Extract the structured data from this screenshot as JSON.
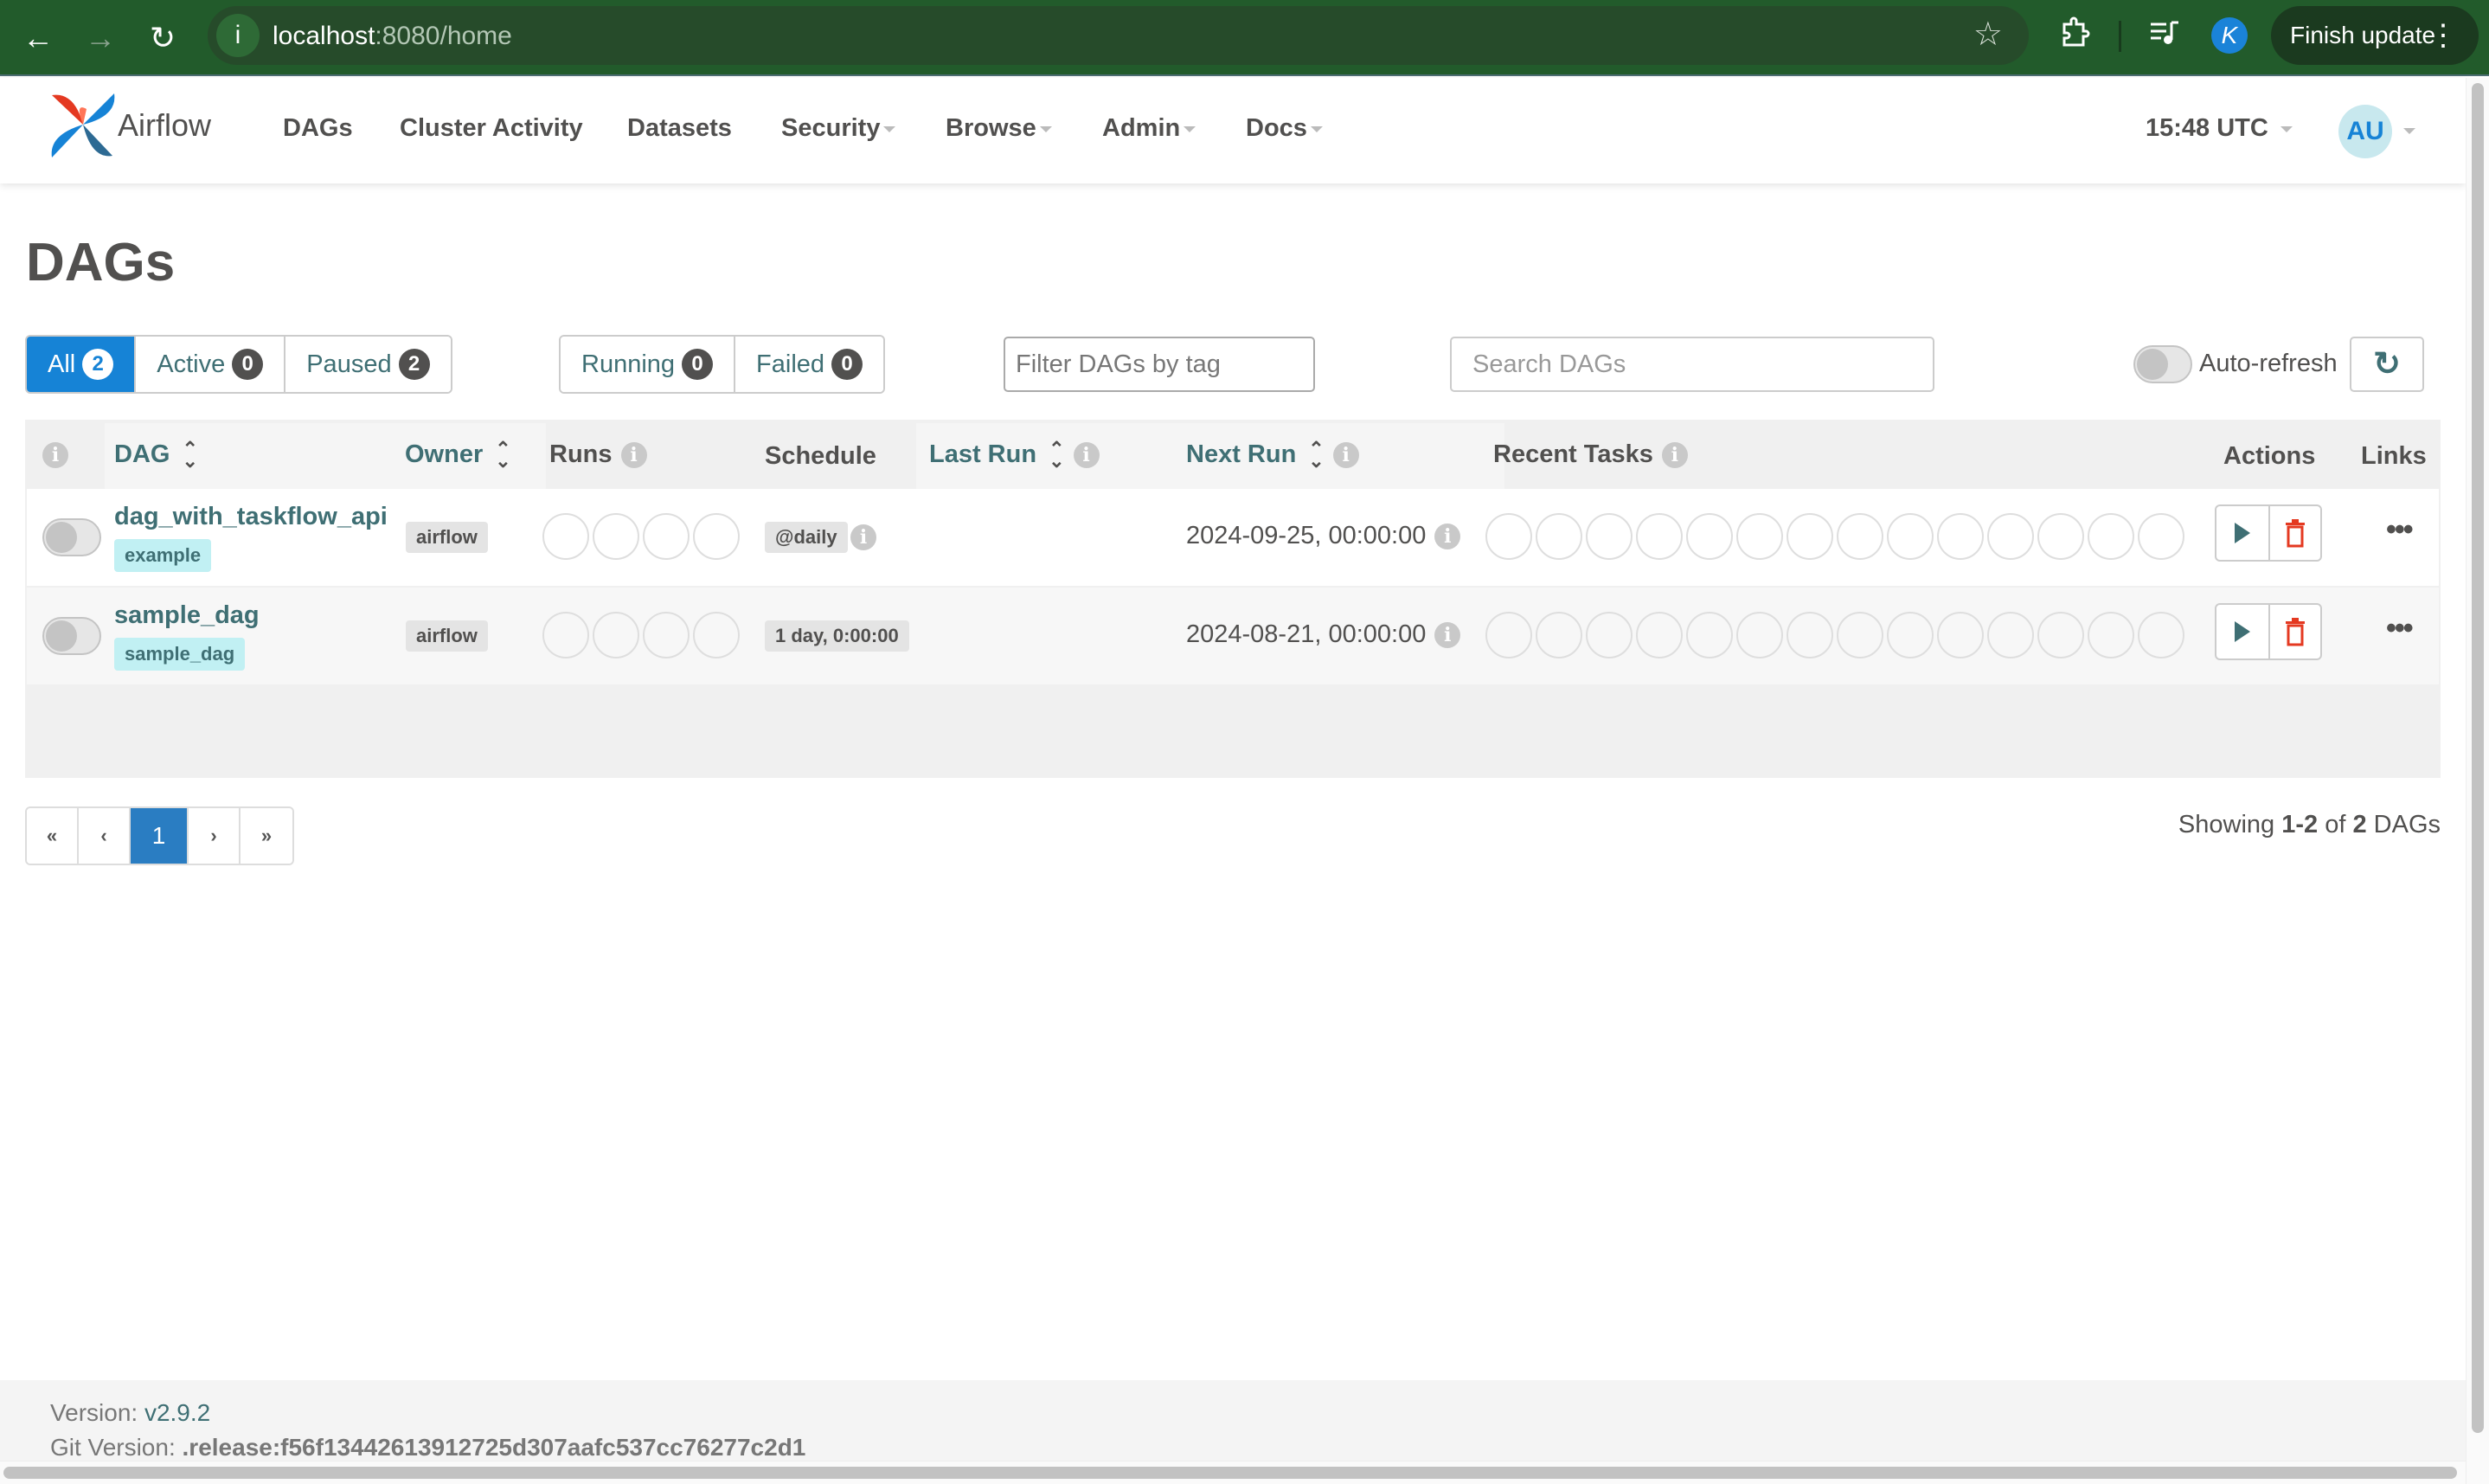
{
  "browser": {
    "url_host": "localhost",
    "url_rest": ":8080/home",
    "profile_initial": "K",
    "finish_update_label": "Finish update"
  },
  "navbar": {
    "brand": "Airflow",
    "items": [
      {
        "label": "DAGs",
        "dropdown": false
      },
      {
        "label": "Cluster Activity",
        "dropdown": false
      },
      {
        "label": "Datasets",
        "dropdown": false
      },
      {
        "label": "Security",
        "dropdown": true
      },
      {
        "label": "Browse",
        "dropdown": true
      },
      {
        "label": "Admin",
        "dropdown": true
      },
      {
        "label": "Docs",
        "dropdown": true
      }
    ],
    "clock": "15:48 UTC",
    "user_initials": "AU"
  },
  "page": {
    "title": "DAGs"
  },
  "status_filters": [
    {
      "label": "All",
      "count": "2",
      "active": true
    },
    {
      "label": "Active",
      "count": "0",
      "active": false
    },
    {
      "label": "Paused",
      "count": "2",
      "active": false
    }
  ],
  "run_filters": [
    {
      "label": "Running",
      "count": "0"
    },
    {
      "label": "Failed",
      "count": "0"
    }
  ],
  "tag_filter": {
    "placeholder": "Filter DAGs by tag",
    "value": ""
  },
  "search": {
    "placeholder": "Search DAGs",
    "value": ""
  },
  "auto_refresh": {
    "label": "Auto-refresh",
    "enabled": false
  },
  "table": {
    "columns": [
      "DAG",
      "Owner",
      "Runs",
      "Schedule",
      "Last Run",
      "Next Run",
      "Recent Tasks",
      "Actions",
      "Links"
    ],
    "rows": [
      {
        "dag_id": "dag_with_taskflow_api",
        "tag": "example",
        "owner": "airflow",
        "schedule": "@daily",
        "last_run": "",
        "next_run": "2024-09-25, 00:00:00",
        "paused": true
      },
      {
        "dag_id": "sample_dag",
        "tag": "sample_dag",
        "owner": "airflow",
        "schedule": "1 day, 0:00:00",
        "last_run": "",
        "next_run": "2024-08-21, 00:00:00",
        "paused": true
      }
    ]
  },
  "pagination": {
    "first": "«",
    "prev": "‹",
    "current": "1",
    "next": "›",
    "last": "»"
  },
  "showing": {
    "prefix": "Showing",
    "range": "1-2",
    "of": "of",
    "total": "2",
    "suffix": "DAGs"
  },
  "footer": {
    "version_label": "Version:",
    "version": "v2.9.2",
    "git_label": "Git Version:",
    "git_version": ".release:f56f13442613912725d307aafc537cc76277c2d1"
  },
  "icons": {
    "back": "←",
    "forward": "→",
    "reload": "↻",
    "info": "i",
    "star": "☆",
    "refresh": "↻",
    "more": "•••",
    "kebab": "⋮"
  }
}
